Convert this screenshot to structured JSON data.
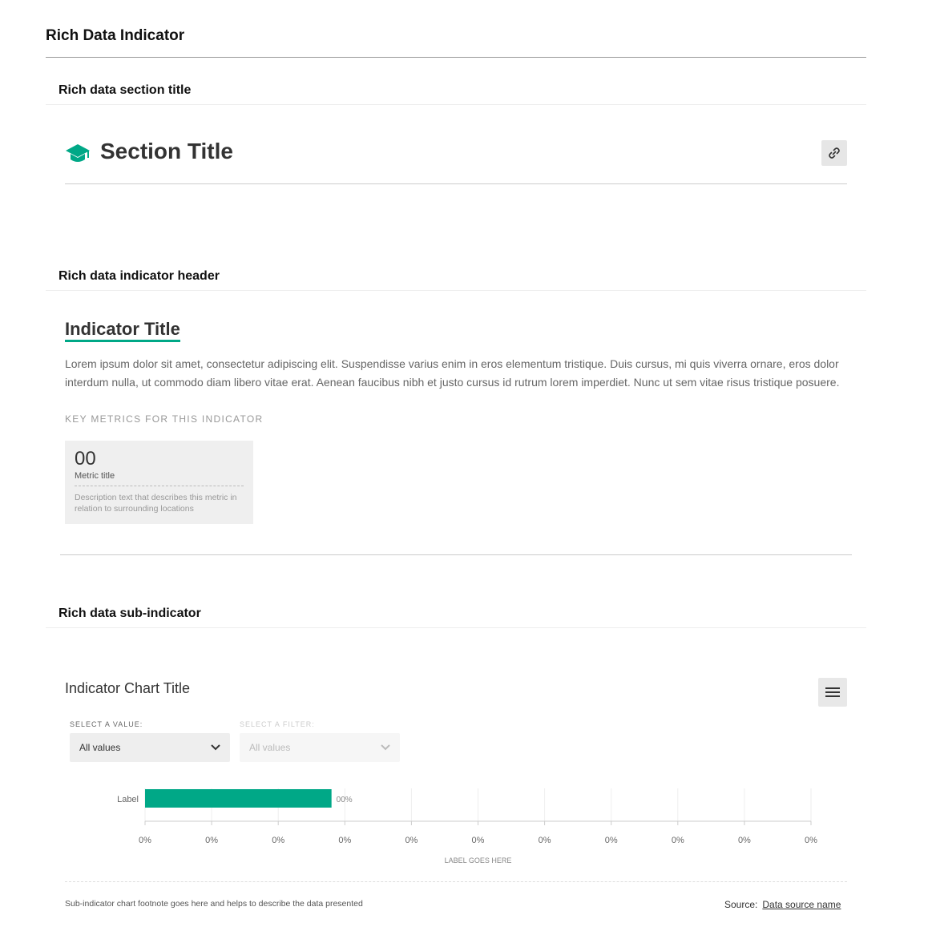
{
  "page": {
    "title": "Rich Data Indicator"
  },
  "sections": {
    "section_title_heading": "Rich data section title",
    "indicator_header_heading": "Rich data indicator header",
    "sub_indicator_heading": "Rich data sub-indicator"
  },
  "section_title": {
    "title": "Section Title",
    "icon": "graduation-cap-icon",
    "link_icon": "link-icon",
    "accent": "#00a887"
  },
  "indicator": {
    "title": "Indicator Title",
    "description": "Lorem ipsum dolor sit amet, consectetur adipiscing elit. Suspendisse varius enim in eros elementum tristique. Duis cursus, mi quis viverra ornare, eros dolor interdum nulla, ut commodo diam libero vitae erat. Aenean faucibus nibh et justo cursus id rutrum lorem imperdiet. Nunc ut sem vitae risus tristique posuere.",
    "key_metrics_label": "KEY METRICS FOR THIS INDICATOR",
    "metric": {
      "value": "00",
      "title": "Metric title",
      "description": "Description text that describes this metric in relation to surrounding locations"
    }
  },
  "sub_indicator": {
    "chart_title": "Indicator Chart Title",
    "menu_icon": "hamburger-menu-icon",
    "select_value": {
      "label": "SELECT A VALUE:",
      "value": "All values"
    },
    "select_filter": {
      "label": "SELECT A FILTER:",
      "value": "All values"
    },
    "footnote": "Sub-indicator chart footnote goes here and helps to describe the data presented",
    "source_label": "Source:",
    "source_link": "Data source name"
  },
  "chart_data": {
    "type": "bar",
    "orientation": "horizontal",
    "categories": [
      "Label"
    ],
    "values": [
      0.28
    ],
    "value_labels": [
      "00%"
    ],
    "x_ticks": [
      "0%",
      "0%",
      "0%",
      "0%",
      "0%",
      "0%",
      "0%",
      "0%",
      "0%",
      "0%",
      "0%"
    ],
    "xlabel": "LABEL GOES HERE",
    "xlim": [
      0,
      1
    ],
    "grid": true,
    "bar_color": "#00a887"
  }
}
